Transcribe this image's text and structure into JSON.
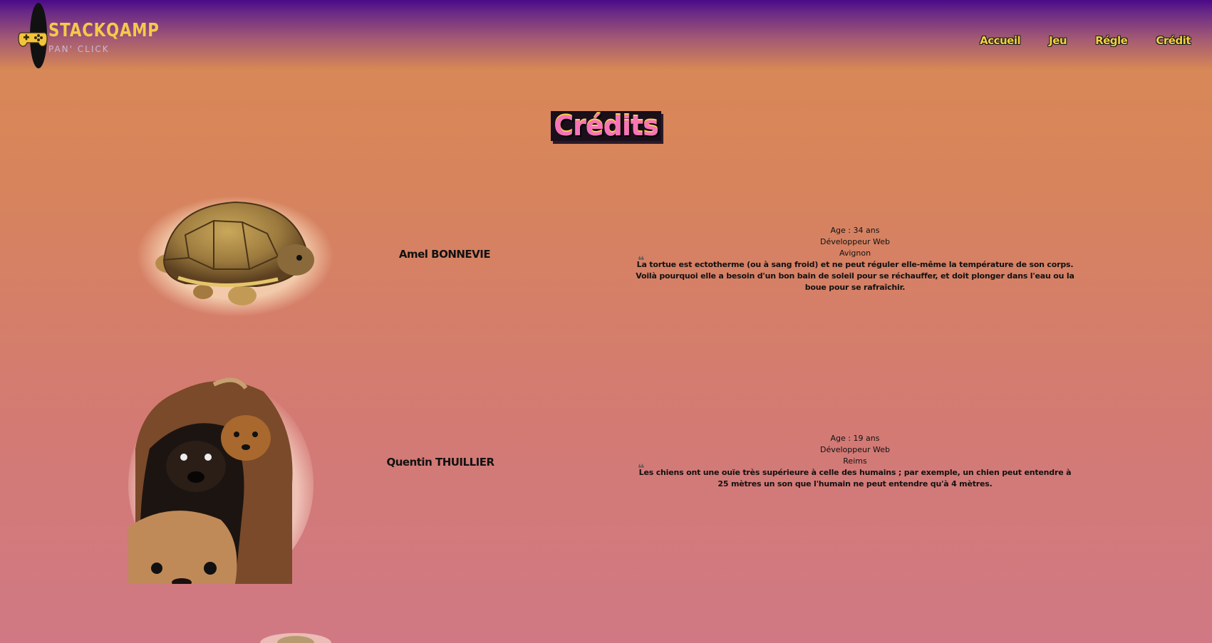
{
  "header": {
    "logo": {
      "title": "STACKQAMP",
      "subtitle": "PAN' CLICK",
      "icon": "gamepad-icon"
    },
    "nav": [
      {
        "label": "Accueil"
      },
      {
        "label": "Jeu"
      },
      {
        "label": "Régle"
      },
      {
        "label": "Crédit"
      }
    ]
  },
  "main": {
    "title": "Crédits",
    "credits": [
      {
        "name": "Amel BONNEVIE",
        "age": "Age : 34 ans",
        "role": "Développeur Web",
        "city": "Avignon",
        "quote": "La tortue est ectotherme (ou à sang froid) et ne peut réguler elle-même la température de son corps. Voilà pourquoi elle a besoin d'un bon bain de soleil pour se réchauffer, et doit plonger dans l'eau ou la boue pour se rafraîchir.",
        "photo": "tortoise-photo"
      },
      {
        "name": "Quentin THUILLIER",
        "age": "Age : 19 ans",
        "role": "Développeur Web",
        "city": "Reims",
        "quote": "Les chiens ont une ouïe très supérieure à celle des humains ; par exemple, un chien peut entendre à 25 mètres un son que l'humain ne peut entendre qu'à 4 mètres.",
        "photo": "dogs-photo"
      }
    ]
  },
  "colors": {
    "header_top": "#4a0a88",
    "nav_link": "#f4d03f",
    "title_pink": "#f774b8",
    "bg_orange": "#d98a55",
    "bg_pink": "#d07984"
  }
}
